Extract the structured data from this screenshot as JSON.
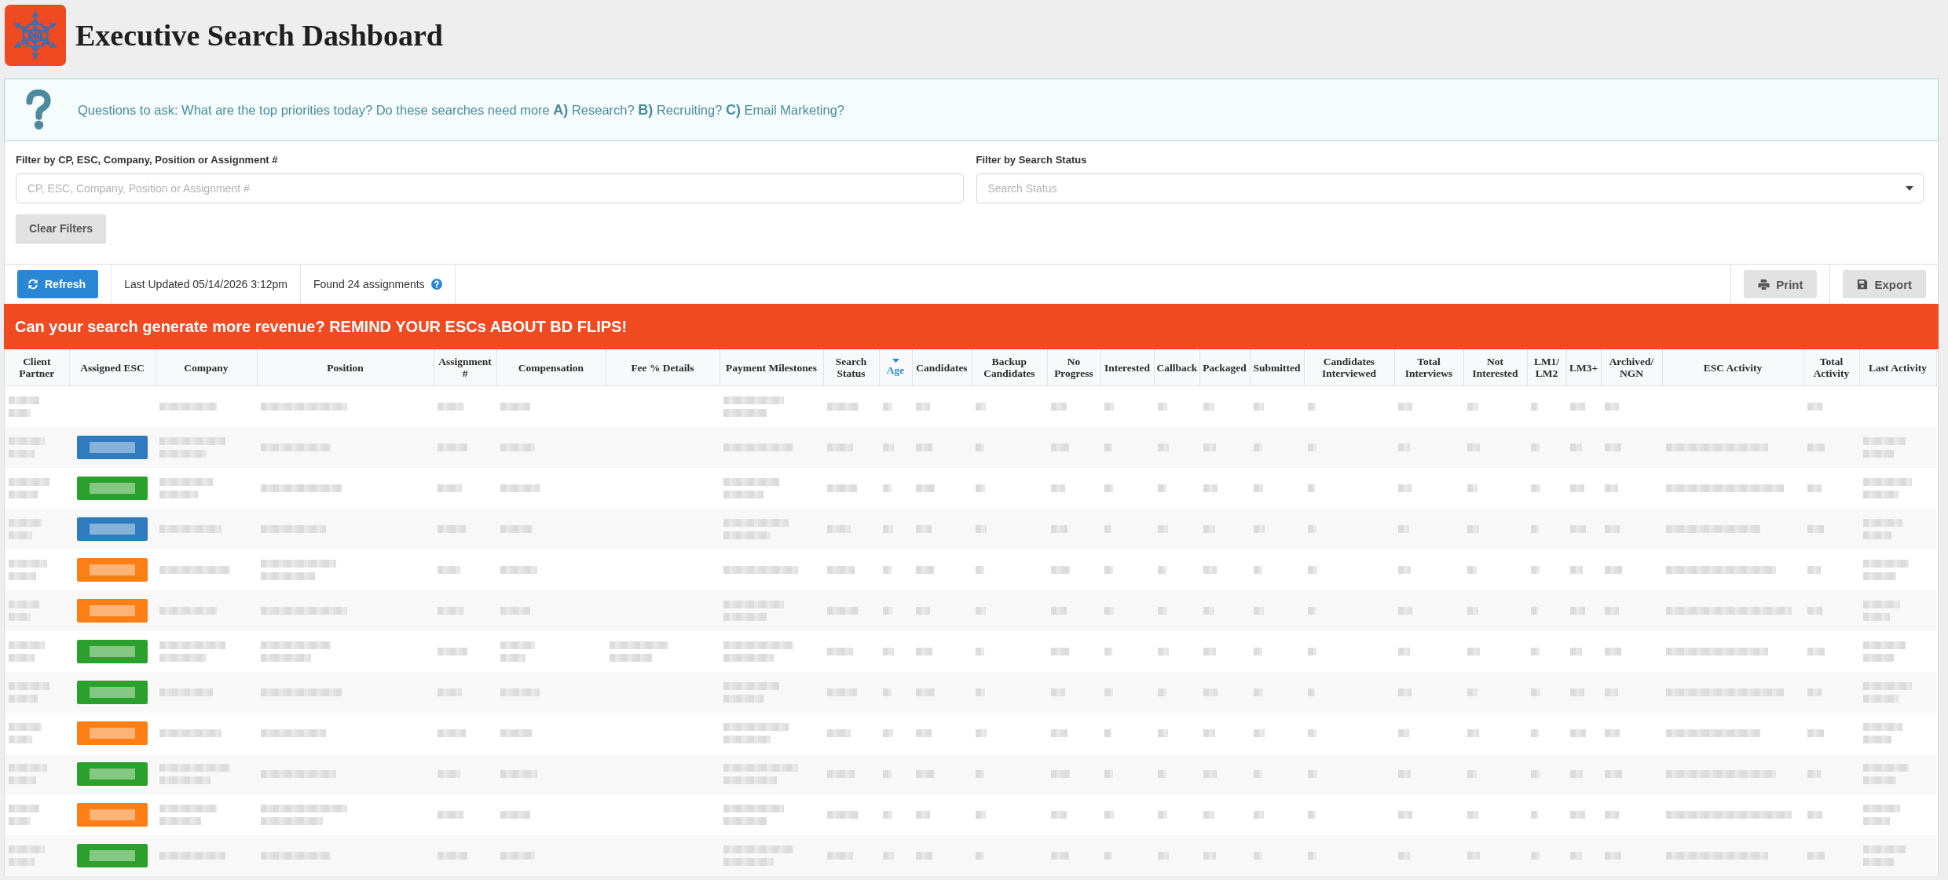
{
  "header": {
    "title": "Executive Search Dashboard"
  },
  "info_banner": {
    "text": "Questions to ask: What are the top priorities today? Do these searches need more **A)** Research? **B)** Recruiting? **C)** Email Marketing?"
  },
  "filters": {
    "fields": [
      {
        "kind": "text",
        "label": "Filter by CP, ESC, Company, Position or Assignment #",
        "placeholder": "CP, ESC, Company, Position or Assignment #"
      },
      {
        "kind": "select",
        "label": "Filter by Search Status",
        "placeholder": "Search Status"
      }
    ],
    "clear_button": "Clear Filters"
  },
  "toolbar": {
    "refresh_button": "Refresh",
    "last_updated": "Last Updated 05/14/2026 3:12pm",
    "found": "Found 24 assignments",
    "print_button": "Print",
    "export_button": "Export"
  },
  "promo_banner": "Can your search generate more revenue? REMIND YOUR ESCs ABOUT BD FLIPS!",
  "table": {
    "columns": [
      {
        "label": "Client Partner",
        "sorted": false
      },
      {
        "label": "Assigned ESC",
        "sorted": false
      },
      {
        "label": "Company",
        "sorted": false
      },
      {
        "label": "Position",
        "sorted": false
      },
      {
        "label": "Assignment #",
        "sorted": false
      },
      {
        "label": "Compensation",
        "sorted": false
      },
      {
        "label": "Fee % Details",
        "sorted": false
      },
      {
        "label": "Payment Milestones",
        "sorted": false
      },
      {
        "label": "Search Status",
        "sorted": false
      },
      {
        "label": "Age",
        "sorted": true
      },
      {
        "label": "Candidates",
        "sorted": false
      },
      {
        "label": "Backup Candidates",
        "sorted": false
      },
      {
        "label": "No Progress",
        "sorted": false
      },
      {
        "label": "Interested",
        "sorted": false
      },
      {
        "label": "Callback",
        "sorted": false
      },
      {
        "label": "Packaged",
        "sorted": false
      },
      {
        "label": "Submitted",
        "sorted": false
      },
      {
        "label": "Candidates Interviewed",
        "sorted": false
      },
      {
        "label": "Total Interviews",
        "sorted": false
      },
      {
        "label": "Not Interested",
        "sorted": false
      },
      {
        "label": "LM1/LM2",
        "sorted": false
      },
      {
        "label": "LM3+",
        "sorted": false
      },
      {
        "label": "Archived/NGN",
        "sorted": false
      },
      {
        "label": "ESC Activity",
        "sorted": false
      },
      {
        "label": "Total Activity",
        "sorted": false
      },
      {
        "label": "Last Activity",
        "sorted": false
      }
    ],
    "rows": [
      {
        "cells": [
          {
            "kind": "lines"
          },
          {
            "kind": "empty"
          },
          {
            "kind": "line"
          },
          {
            "kind": "line"
          },
          {
            "kind": "line"
          },
          {
            "kind": "line"
          },
          {
            "kind": "empty"
          },
          {
            "kind": "lines"
          },
          {
            "kind": "line"
          },
          {
            "kind": "line"
          },
          {
            "kind": "line"
          },
          {
            "kind": "line"
          },
          {
            "kind": "line"
          },
          {
            "kind": "line"
          },
          {
            "kind": "line"
          },
          {
            "kind": "line"
          },
          {
            "kind": "line"
          },
          {
            "kind": "line"
          },
          {
            "kind": "line"
          },
          {
            "kind": "line"
          },
          {
            "kind": "line"
          },
          {
            "kind": "line"
          },
          {
            "kind": "line"
          },
          {
            "kind": "empty"
          },
          {
            "kind": "line"
          },
          {
            "kind": "empty"
          }
        ]
      },
      {
        "cells": [
          {
            "kind": "lines"
          },
          {
            "kind": "badge",
            "color": "#2f7bbf"
          },
          {
            "kind": "lines"
          },
          {
            "kind": "line"
          },
          {
            "kind": "line"
          },
          {
            "kind": "line"
          },
          {
            "kind": "empty"
          },
          {
            "kind": "line"
          },
          {
            "kind": "line"
          },
          {
            "kind": "line"
          },
          {
            "kind": "line"
          },
          {
            "kind": "line"
          },
          {
            "kind": "line"
          },
          {
            "kind": "line"
          },
          {
            "kind": "line"
          },
          {
            "kind": "line"
          },
          {
            "kind": "line"
          },
          {
            "kind": "line"
          },
          {
            "kind": "line"
          },
          {
            "kind": "line"
          },
          {
            "kind": "line"
          },
          {
            "kind": "line"
          },
          {
            "kind": "line"
          },
          {
            "kind": "line"
          },
          {
            "kind": "line"
          },
          {
            "kind": "lines"
          }
        ]
      },
      {
        "cells": [
          {
            "kind": "lines"
          },
          {
            "kind": "badge",
            "color": "#2ca02c"
          },
          {
            "kind": "lines"
          },
          {
            "kind": "line"
          },
          {
            "kind": "line"
          },
          {
            "kind": "line"
          },
          {
            "kind": "empty"
          },
          {
            "kind": "lines"
          },
          {
            "kind": "line"
          },
          {
            "kind": "line"
          },
          {
            "kind": "line"
          },
          {
            "kind": "line"
          },
          {
            "kind": "line"
          },
          {
            "kind": "line"
          },
          {
            "kind": "line"
          },
          {
            "kind": "line"
          },
          {
            "kind": "line"
          },
          {
            "kind": "line"
          },
          {
            "kind": "line"
          },
          {
            "kind": "line"
          },
          {
            "kind": "line"
          },
          {
            "kind": "line"
          },
          {
            "kind": "line"
          },
          {
            "kind": "line"
          },
          {
            "kind": "line"
          },
          {
            "kind": "lines"
          }
        ]
      },
      {
        "cells": [
          {
            "kind": "lines"
          },
          {
            "kind": "badge",
            "color": "#2f7bbf"
          },
          {
            "kind": "line"
          },
          {
            "kind": "line"
          },
          {
            "kind": "line"
          },
          {
            "kind": "line"
          },
          {
            "kind": "empty"
          },
          {
            "kind": "lines"
          },
          {
            "kind": "line"
          },
          {
            "kind": "line"
          },
          {
            "kind": "line"
          },
          {
            "kind": "line"
          },
          {
            "kind": "line"
          },
          {
            "kind": "line"
          },
          {
            "kind": "line"
          },
          {
            "kind": "line"
          },
          {
            "kind": "line"
          },
          {
            "kind": "line"
          },
          {
            "kind": "line"
          },
          {
            "kind": "line"
          },
          {
            "kind": "line"
          },
          {
            "kind": "line"
          },
          {
            "kind": "line"
          },
          {
            "kind": "line"
          },
          {
            "kind": "line"
          },
          {
            "kind": "lines"
          }
        ]
      },
      {
        "cells": [
          {
            "kind": "lines"
          },
          {
            "kind": "badge",
            "color": "#fd7e14"
          },
          {
            "kind": "line"
          },
          {
            "kind": "lines"
          },
          {
            "kind": "line"
          },
          {
            "kind": "line"
          },
          {
            "kind": "empty"
          },
          {
            "kind": "line"
          },
          {
            "kind": "line"
          },
          {
            "kind": "line"
          },
          {
            "kind": "line"
          },
          {
            "kind": "line"
          },
          {
            "kind": "line"
          },
          {
            "kind": "line"
          },
          {
            "kind": "line"
          },
          {
            "kind": "line"
          },
          {
            "kind": "line"
          },
          {
            "kind": "line"
          },
          {
            "kind": "line"
          },
          {
            "kind": "line"
          },
          {
            "kind": "line"
          },
          {
            "kind": "line"
          },
          {
            "kind": "line"
          },
          {
            "kind": "line"
          },
          {
            "kind": "line"
          },
          {
            "kind": "lines"
          }
        ]
      },
      {
        "cells": [
          {
            "kind": "lines"
          },
          {
            "kind": "badge",
            "color": "#fd7e14"
          },
          {
            "kind": "line"
          },
          {
            "kind": "line"
          },
          {
            "kind": "line"
          },
          {
            "kind": "line"
          },
          {
            "kind": "empty"
          },
          {
            "kind": "lines"
          },
          {
            "kind": "line"
          },
          {
            "kind": "line"
          },
          {
            "kind": "line"
          },
          {
            "kind": "line"
          },
          {
            "kind": "line"
          },
          {
            "kind": "line"
          },
          {
            "kind": "line"
          },
          {
            "kind": "line"
          },
          {
            "kind": "line"
          },
          {
            "kind": "line"
          },
          {
            "kind": "line"
          },
          {
            "kind": "line"
          },
          {
            "kind": "line"
          },
          {
            "kind": "line"
          },
          {
            "kind": "line"
          },
          {
            "kind": "line"
          },
          {
            "kind": "line"
          },
          {
            "kind": "lines"
          }
        ]
      },
      {
        "cells": [
          {
            "kind": "lines"
          },
          {
            "kind": "badge",
            "color": "#2ca02c"
          },
          {
            "kind": "lines"
          },
          {
            "kind": "lines"
          },
          {
            "kind": "line"
          },
          {
            "kind": "lines"
          },
          {
            "kind": "lines"
          },
          {
            "kind": "lines"
          },
          {
            "kind": "line"
          },
          {
            "kind": "line"
          },
          {
            "kind": "line"
          },
          {
            "kind": "line"
          },
          {
            "kind": "line"
          },
          {
            "kind": "line"
          },
          {
            "kind": "line"
          },
          {
            "kind": "line"
          },
          {
            "kind": "line"
          },
          {
            "kind": "line"
          },
          {
            "kind": "line"
          },
          {
            "kind": "line"
          },
          {
            "kind": "line"
          },
          {
            "kind": "line"
          },
          {
            "kind": "line"
          },
          {
            "kind": "line"
          },
          {
            "kind": "line"
          },
          {
            "kind": "lines"
          }
        ]
      },
      {
        "cells": [
          {
            "kind": "lines"
          },
          {
            "kind": "badge",
            "color": "#2ca02c"
          },
          {
            "kind": "line"
          },
          {
            "kind": "line"
          },
          {
            "kind": "line"
          },
          {
            "kind": "line"
          },
          {
            "kind": "empty"
          },
          {
            "kind": "lines"
          },
          {
            "kind": "line"
          },
          {
            "kind": "line"
          },
          {
            "kind": "line"
          },
          {
            "kind": "line"
          },
          {
            "kind": "line"
          },
          {
            "kind": "line"
          },
          {
            "kind": "line"
          },
          {
            "kind": "line"
          },
          {
            "kind": "line"
          },
          {
            "kind": "line"
          },
          {
            "kind": "line"
          },
          {
            "kind": "line"
          },
          {
            "kind": "line"
          },
          {
            "kind": "line"
          },
          {
            "kind": "line"
          },
          {
            "kind": "line"
          },
          {
            "kind": "line"
          },
          {
            "kind": "lines"
          }
        ]
      },
      {
        "cells": [
          {
            "kind": "lines"
          },
          {
            "kind": "badge",
            "color": "#fd7e14"
          },
          {
            "kind": "line"
          },
          {
            "kind": "line"
          },
          {
            "kind": "line"
          },
          {
            "kind": "line"
          },
          {
            "kind": "empty"
          },
          {
            "kind": "lines"
          },
          {
            "kind": "line"
          },
          {
            "kind": "line"
          },
          {
            "kind": "line"
          },
          {
            "kind": "line"
          },
          {
            "kind": "line"
          },
          {
            "kind": "line"
          },
          {
            "kind": "line"
          },
          {
            "kind": "line"
          },
          {
            "kind": "line"
          },
          {
            "kind": "line"
          },
          {
            "kind": "line"
          },
          {
            "kind": "line"
          },
          {
            "kind": "line"
          },
          {
            "kind": "line"
          },
          {
            "kind": "line"
          },
          {
            "kind": "line"
          },
          {
            "kind": "line"
          },
          {
            "kind": "lines"
          }
        ]
      },
      {
        "cells": [
          {
            "kind": "lines"
          },
          {
            "kind": "badge",
            "color": "#2ca02c"
          },
          {
            "kind": "lines"
          },
          {
            "kind": "line"
          },
          {
            "kind": "line"
          },
          {
            "kind": "line"
          },
          {
            "kind": "empty"
          },
          {
            "kind": "lines"
          },
          {
            "kind": "line"
          },
          {
            "kind": "line"
          },
          {
            "kind": "line"
          },
          {
            "kind": "line"
          },
          {
            "kind": "line"
          },
          {
            "kind": "line"
          },
          {
            "kind": "line"
          },
          {
            "kind": "line"
          },
          {
            "kind": "line"
          },
          {
            "kind": "line"
          },
          {
            "kind": "line"
          },
          {
            "kind": "line"
          },
          {
            "kind": "line"
          },
          {
            "kind": "line"
          },
          {
            "kind": "line"
          },
          {
            "kind": "line"
          },
          {
            "kind": "line"
          },
          {
            "kind": "lines"
          }
        ]
      },
      {
        "cells": [
          {
            "kind": "lines"
          },
          {
            "kind": "badge",
            "color": "#fd7e14"
          },
          {
            "kind": "lines"
          },
          {
            "kind": "lines"
          },
          {
            "kind": "line"
          },
          {
            "kind": "line"
          },
          {
            "kind": "empty"
          },
          {
            "kind": "lines"
          },
          {
            "kind": "line"
          },
          {
            "kind": "line"
          },
          {
            "kind": "line"
          },
          {
            "kind": "line"
          },
          {
            "kind": "line"
          },
          {
            "kind": "line"
          },
          {
            "kind": "line"
          },
          {
            "kind": "line"
          },
          {
            "kind": "line"
          },
          {
            "kind": "line"
          },
          {
            "kind": "line"
          },
          {
            "kind": "line"
          },
          {
            "kind": "line"
          },
          {
            "kind": "line"
          },
          {
            "kind": "line"
          },
          {
            "kind": "line"
          },
          {
            "kind": "line"
          },
          {
            "kind": "lines"
          }
        ]
      },
      {
        "cells": [
          {
            "kind": "lines"
          },
          {
            "kind": "badge",
            "color": "#2ca02c"
          },
          {
            "kind": "line"
          },
          {
            "kind": "line"
          },
          {
            "kind": "line"
          },
          {
            "kind": "line"
          },
          {
            "kind": "empty"
          },
          {
            "kind": "lines"
          },
          {
            "kind": "line"
          },
          {
            "kind": "line"
          },
          {
            "kind": "line"
          },
          {
            "kind": "line"
          },
          {
            "kind": "line"
          },
          {
            "kind": "line"
          },
          {
            "kind": "line"
          },
          {
            "kind": "line"
          },
          {
            "kind": "line"
          },
          {
            "kind": "line"
          },
          {
            "kind": "line"
          },
          {
            "kind": "line"
          },
          {
            "kind": "line"
          },
          {
            "kind": "line"
          },
          {
            "kind": "line"
          },
          {
            "kind": "line"
          },
          {
            "kind": "line"
          },
          {
            "kind": "lines"
          }
        ]
      }
    ]
  }
}
